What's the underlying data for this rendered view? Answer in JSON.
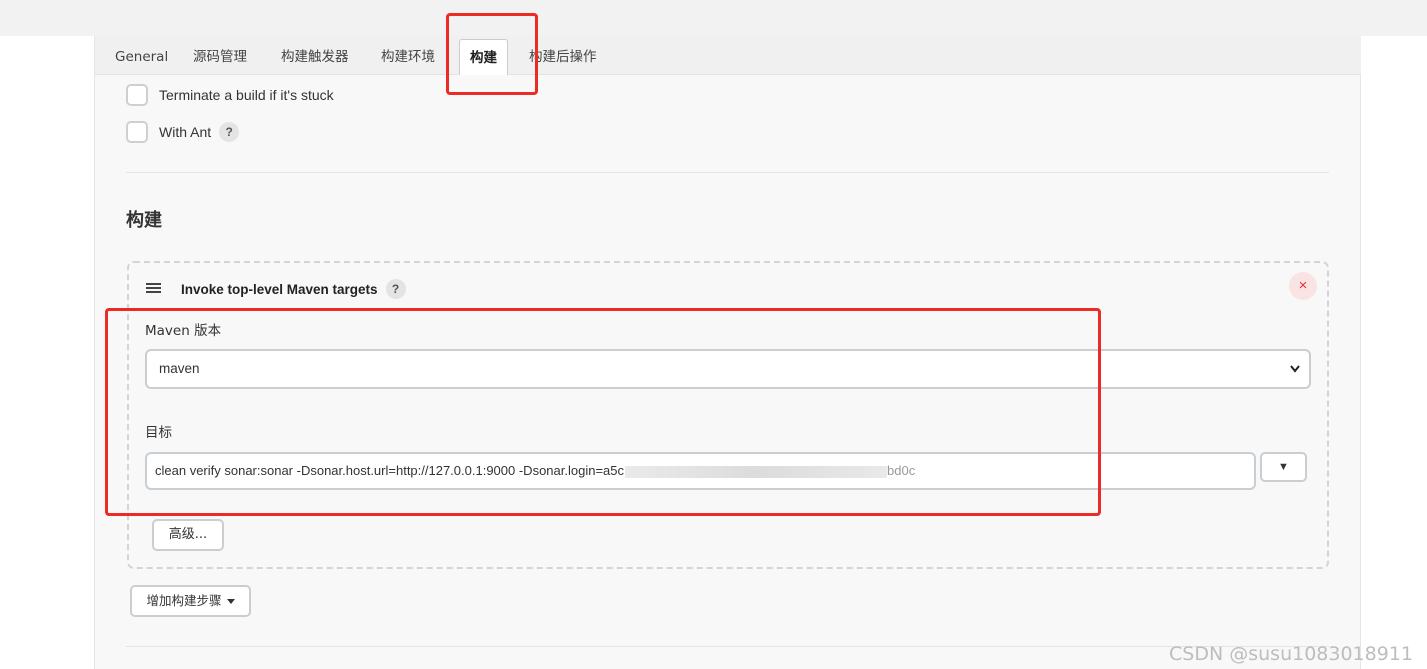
{
  "tabs": [
    {
      "label": "General"
    },
    {
      "label": "源码管理"
    },
    {
      "label": "构建触发器"
    },
    {
      "label": "构建环境"
    },
    {
      "label": "构建"
    },
    {
      "label": "构建后操作"
    }
  ],
  "build_env_options": [
    {
      "label": "Terminate a build if it's stuck"
    },
    {
      "label": "With Ant",
      "help": "?"
    }
  ],
  "section": {
    "title": "构建"
  },
  "build_step": {
    "title": "Invoke top-level Maven targets",
    "help": "?",
    "close": "×",
    "maven_version_label": "Maven 版本",
    "maven_version_value": "maven",
    "goals_label": "目标",
    "goals_value": "clean verify sonar:sonar -Dsonar.host.url=http://127.0.0.1:9000 -Dsonar.login=a5c",
    "goals_value_tail": "bd0c",
    "expand_symbol": "▼",
    "advanced_label": "高级..."
  },
  "add_step_label": "增加构建步骤",
  "watermark": "CSDN @susu1083018911",
  "colors": {
    "highlight": "#ec2b26"
  }
}
